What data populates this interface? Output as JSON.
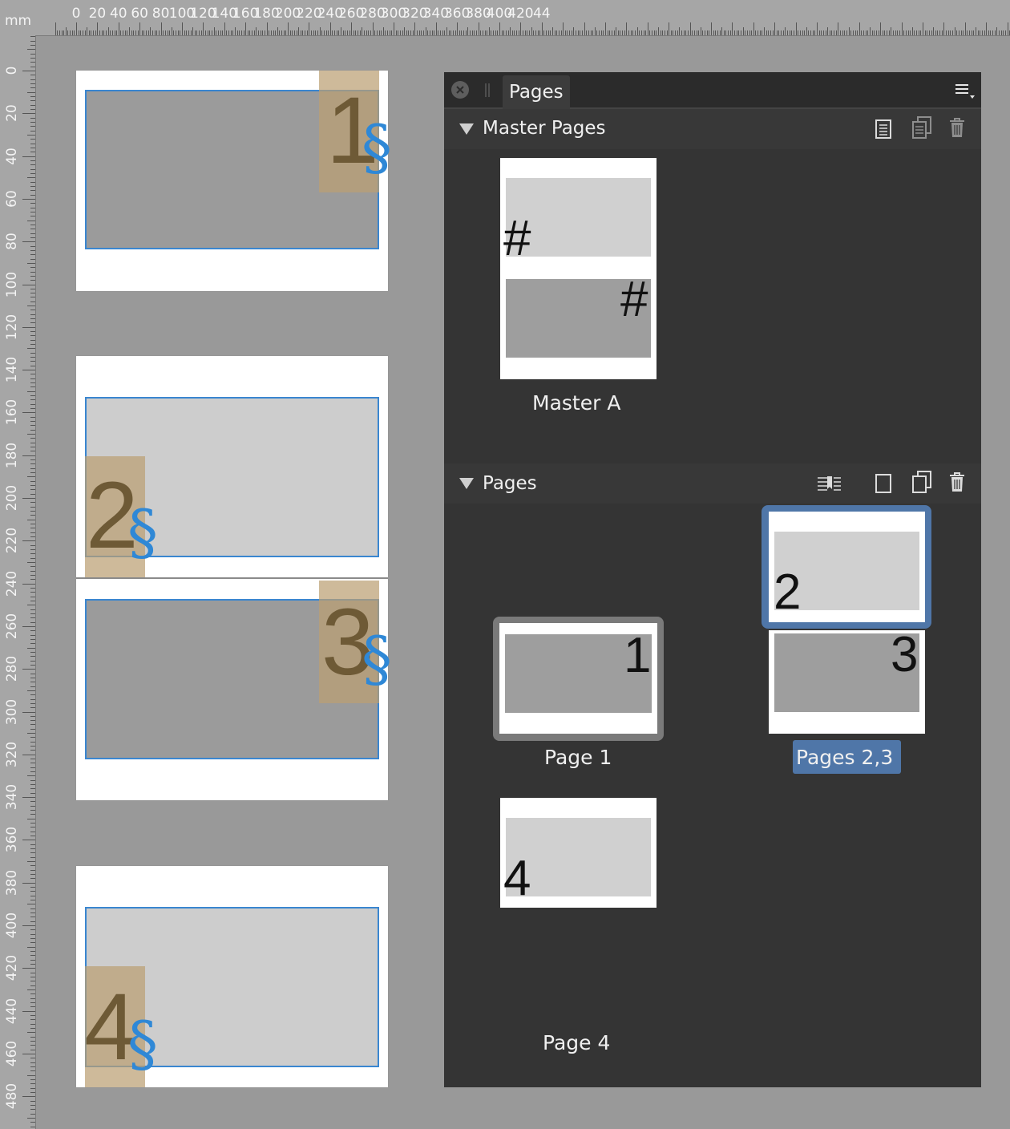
{
  "ruler": {
    "unit": "mm",
    "top_labels": [
      "0",
      "20",
      "40",
      "60",
      "80",
      "100",
      "120",
      "140",
      "160",
      "180",
      "200",
      "220",
      "240",
      "260",
      "280",
      "300",
      "320",
      "340",
      "360",
      "380",
      "400",
      "420",
      "44"
    ],
    "left_labels": [
      "0",
      "20",
      "40",
      "60",
      "80",
      "100",
      "120",
      "140",
      "160",
      "180",
      "200",
      "220",
      "240",
      "260",
      "280",
      "300",
      "320",
      "340",
      "360",
      "380",
      "400",
      "420",
      "440",
      "460",
      "480",
      "0"
    ]
  },
  "canvas": {
    "page1": {
      "number": "1",
      "section_mark": "§"
    },
    "page2": {
      "number": "2",
      "section_mark": "§"
    },
    "page3": {
      "number": "3",
      "section_mark": "§"
    },
    "page4": {
      "number": "4",
      "section_mark": "§"
    }
  },
  "panel": {
    "tab_title": "Pages",
    "master_section": {
      "title": "Master Pages",
      "master_label": "Master A",
      "master_marks": [
        "#",
        "#"
      ]
    },
    "pages_section": {
      "title": "Pages",
      "items": [
        {
          "label": "Page 1",
          "numbers": [
            "1"
          ]
        },
        {
          "label": "Pages 2,3",
          "numbers": [
            "2",
            "3"
          ],
          "selected": true
        },
        {
          "label": "Page 4",
          "numbers": [
            "4"
          ]
        }
      ]
    },
    "colors": {
      "selection": "#4f76a8",
      "panel_bg": "#343434"
    }
  }
}
